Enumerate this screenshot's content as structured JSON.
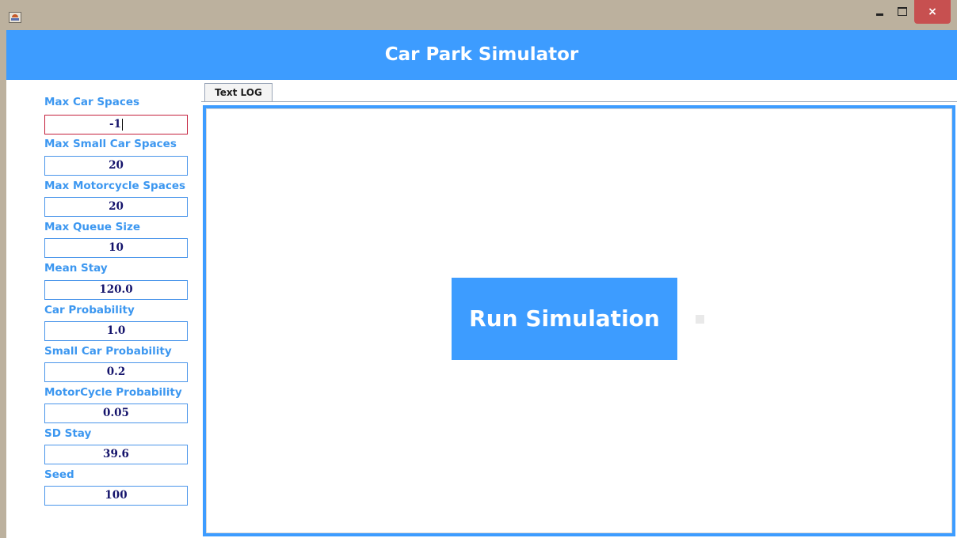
{
  "window": {
    "close_glyph": "×",
    "icons": [
      "java-app-icon",
      "minimize-icon",
      "maximize-icon",
      "close-icon"
    ]
  },
  "app": {
    "title": "Car Park Simulator"
  },
  "fields": [
    {
      "label": "Max Car Spaces",
      "value": "-1",
      "error": true
    },
    {
      "label": "Max Small Car Spaces",
      "value": "20"
    },
    {
      "label": "Max Motorcycle Spaces",
      "value": "20"
    },
    {
      "label": "Max Queue Size",
      "value": "10"
    },
    {
      "label": "Mean Stay",
      "value": "120.0"
    },
    {
      "label": "Car Probability",
      "value": "1.0"
    },
    {
      "label": "Small Car Probability",
      "value": "0.2"
    },
    {
      "label": "MotorCycle Probability",
      "value": "0.05"
    },
    {
      "label": "SD Stay",
      "value": "39.6"
    },
    {
      "label": "Seed",
      "value": "100"
    }
  ],
  "tabs": [
    {
      "label": "Text LOG",
      "selected": true
    }
  ],
  "main": {
    "run_button_label": "Run Simulation"
  },
  "colors": {
    "accent": "#3d9cff",
    "label_text": "#3c97f0",
    "value_text": "#14136b",
    "error_border": "#c4203c"
  }
}
